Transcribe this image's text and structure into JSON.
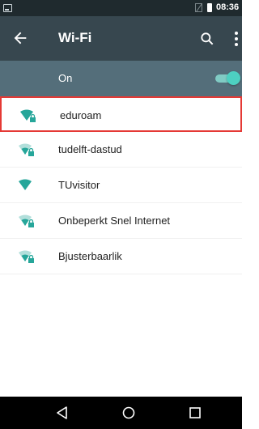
{
  "status_bar": {
    "time": "08:36"
  },
  "toolbar": {
    "title": "Wi-Fi"
  },
  "wifi_switch": {
    "label": "On",
    "state": "on"
  },
  "networks": [
    {
      "ssid": "eduroam",
      "secured": true,
      "highlighted": true
    },
    {
      "ssid": "tudelft-dastud",
      "secured": true
    },
    {
      "ssid": "TUvisitor",
      "secured": false
    },
    {
      "ssid": "Onbeperkt Snel Internet",
      "secured": true
    },
    {
      "ssid": "Bjusterbaarlik",
      "secured": true
    }
  ],
  "colors": {
    "status_bar": "#1f2a2e",
    "toolbar": "#37474f",
    "switch_bar": "#546e7a",
    "accent": "#26a69a",
    "highlight_border": "#e53935"
  },
  "icons": {
    "back": "arrow-left-icon",
    "search": "search-icon",
    "more": "more-vertical-icon",
    "wifi": "wifi-signal-icon",
    "lock": "lock-icon"
  }
}
